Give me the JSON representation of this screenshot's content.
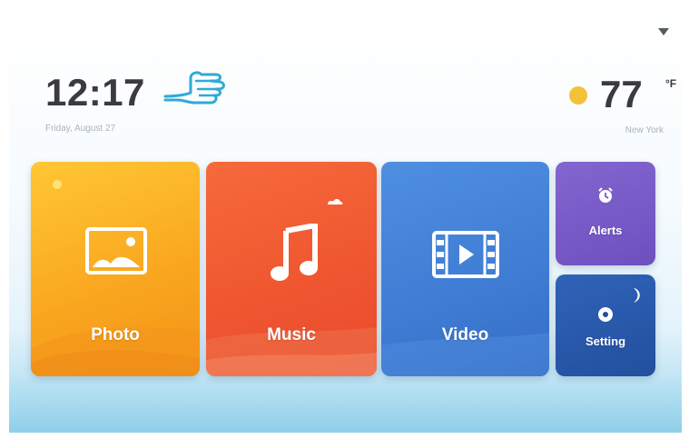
{
  "status": {
    "time": "12:17",
    "date": "Friday, August 27",
    "temperature": "77",
    "temperature_unit": "°F",
    "city": "New York"
  },
  "tiles": {
    "photo": {
      "label": "Photo",
      "icon": "image-icon",
      "color": "#f9a51e"
    },
    "music": {
      "label": "Music",
      "icon": "music-note-icon",
      "color": "#ef5530"
    },
    "video": {
      "label": "Video",
      "icon": "film-play-icon",
      "color": "#3f7cd4"
    },
    "alerts": {
      "label": "Alerts",
      "icon": "alarm-icon",
      "color": "#6d4fbf"
    },
    "setting": {
      "label": "Setting",
      "icon": "gear-icon",
      "color": "#234f9e"
    }
  },
  "icons": {
    "wifi": "wifi-icon",
    "pointer": "hand-pointer-icon",
    "weather": "sun-icon"
  }
}
